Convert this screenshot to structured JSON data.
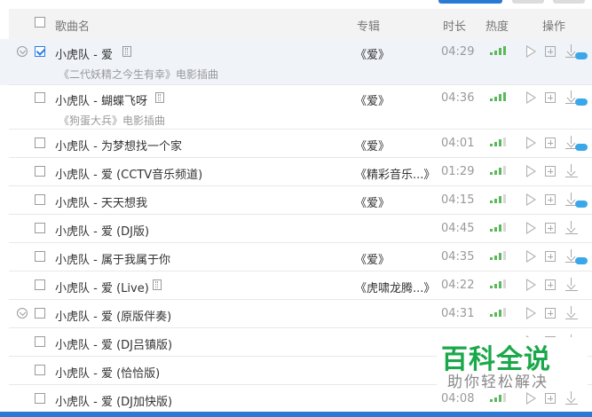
{
  "header": {
    "song_name": "歌曲名",
    "album": "专辑",
    "duration": "时长",
    "heat": "热度",
    "actions": "操作"
  },
  "rows": [
    {
      "title": "小虎队 - 爱",
      "album": "《爱》",
      "duration": "04:29",
      "subtitle": "《二代妖精之今生有幸》电影插曲",
      "checked": true,
      "mv": true,
      "heat": 5,
      "vip": true,
      "expand": true
    },
    {
      "title": "小虎队 - 蝴蝶飞呀",
      "album": "《爱》",
      "duration": "04:36",
      "subtitle": "《狗蛋大兵》电影插曲",
      "checked": false,
      "mv": true,
      "heat": 4,
      "vip": true,
      "expand": false
    },
    {
      "title": "小虎队 - 为梦想找一个家",
      "album": "《爱》",
      "duration": "04:01",
      "subtitle": "",
      "checked": false,
      "mv": false,
      "heat": 3,
      "vip": true,
      "expand": false
    },
    {
      "title": "小虎队 - 爱 (CCTV音乐频道)",
      "album": "《精彩音乐...》",
      "duration": "01:29",
      "subtitle": "",
      "checked": false,
      "mv": false,
      "heat": 3,
      "vip": false,
      "expand": false
    },
    {
      "title": "小虎队 - 天天想我",
      "album": "《爱》",
      "duration": "04:15",
      "subtitle": "",
      "checked": false,
      "mv": false,
      "heat": 3,
      "vip": true,
      "expand": false
    },
    {
      "title": "小虎队 - 爱 (DJ版)",
      "album": "",
      "duration": "04:45",
      "subtitle": "",
      "checked": false,
      "mv": false,
      "heat": 3,
      "vip": false,
      "expand": false
    },
    {
      "title": "小虎队 - 属于我属于你",
      "album": "《爱》",
      "duration": "04:35",
      "subtitle": "",
      "checked": false,
      "mv": false,
      "heat": 3,
      "vip": true,
      "expand": false
    },
    {
      "title": "小虎队 - 爱 (Live)",
      "album": "《虎啸龙腾...》",
      "duration": "04:22",
      "subtitle": "",
      "checked": false,
      "mv": true,
      "heat": 3,
      "vip": false,
      "expand": false
    },
    {
      "title": "小虎队 - 爱 (原版伴奏)",
      "album": "",
      "duration": "04:31",
      "subtitle": "",
      "checked": false,
      "mv": false,
      "heat": 3,
      "vip": false,
      "expand": true
    },
    {
      "title": "小虎队 - 爱 (DJ吕镇版)",
      "album": "",
      "duration": "",
      "subtitle": "",
      "checked": false,
      "mv": false,
      "heat": 0,
      "vip": false,
      "expand": false
    },
    {
      "title": "小虎队 - 爱 (恰恰版)",
      "album": "",
      "duration": "",
      "subtitle": "",
      "checked": false,
      "mv": false,
      "heat": 0,
      "vip": false,
      "expand": false
    },
    {
      "title": "小虎队 - 爱 (DJ加快版)",
      "album": "",
      "duration": "04:08",
      "subtitle": "",
      "checked": false,
      "mv": false,
      "heat": 3,
      "vip": false,
      "expand": false
    }
  ],
  "watermark": {
    "title": "百科全说",
    "subtitle": "助你轻松解决"
  },
  "colors": {
    "accent": "#2a79d5",
    "heat_on": "#5bb85b",
    "watermark": "#1aa84a"
  }
}
